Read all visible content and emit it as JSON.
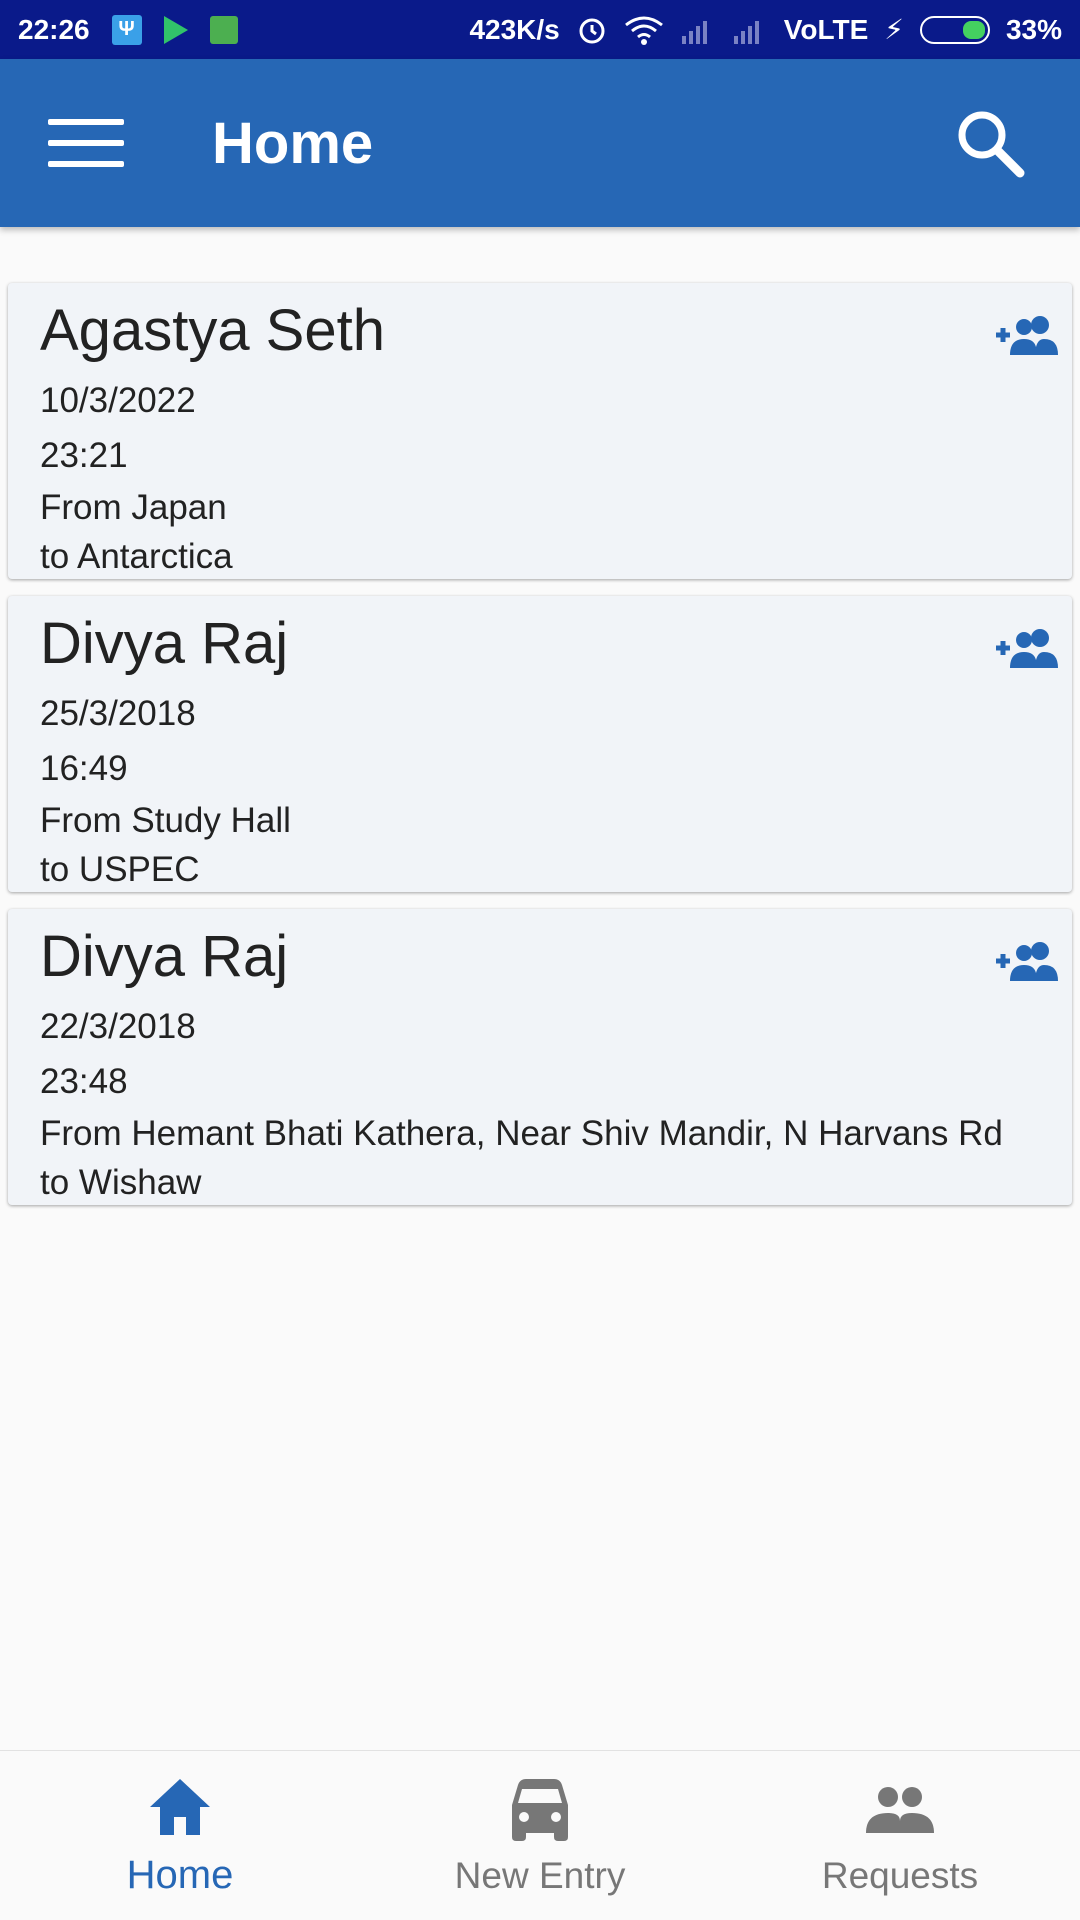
{
  "status_bar": {
    "time": "22:26",
    "speed": "423K/s",
    "network": "VoLTE",
    "battery": "33%",
    "battery_level": 0.33
  },
  "app_bar": {
    "title": "Home"
  },
  "entries": [
    {
      "name": "Agastya Seth",
      "date": "10/3/2022",
      "time": "23:21",
      "from": "From Japan",
      "to": "to Antarctica"
    },
    {
      "name": "Divya Raj",
      "date": "25/3/2018",
      "time": "16:49",
      "from": "From Study Hall",
      "to": "to USPEC"
    },
    {
      "name": "Divya Raj",
      "date": "22/3/2018",
      "time": "23:48",
      "from": "From Hemant Bhati Kathera, Near Shiv Mandir, N Harvans Rd",
      "to": "to Wishaw"
    }
  ],
  "bottom_nav": {
    "items": [
      {
        "label": "Home",
        "icon": "home-icon",
        "active": true
      },
      {
        "label": "New Entry",
        "icon": "car-icon",
        "active": false
      },
      {
        "label": "Requests",
        "icon": "people-icon",
        "active": false
      }
    ]
  },
  "colors": {
    "primary": "#2667b5",
    "status_bar": "#0a1a8a",
    "inactive": "#777777"
  }
}
